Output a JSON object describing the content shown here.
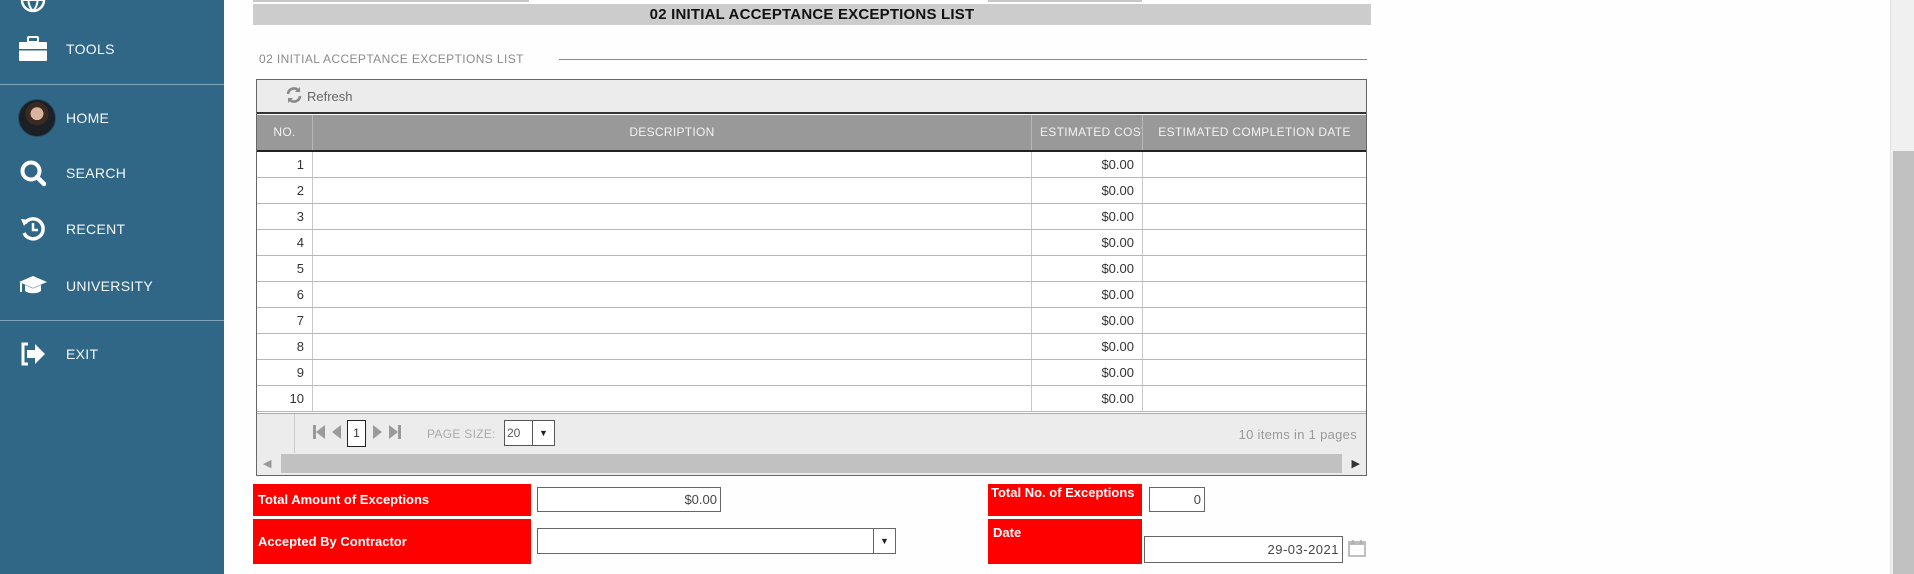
{
  "sidebar": {
    "items": [
      {
        "label": "TOOLS",
        "icon": "briefcase-icon"
      },
      {
        "label": "HOME",
        "icon": "avatar"
      },
      {
        "label": "SEARCH",
        "icon": "search-icon"
      },
      {
        "label": "RECENT",
        "icon": "history-icon"
      },
      {
        "label": "UNIVERSITY",
        "icon": "graduation-cap-icon"
      },
      {
        "label": "EXIT",
        "icon": "exit-icon"
      }
    ]
  },
  "section": {
    "title": "02 INITIAL ACCEPTANCE EXCEPTIONS LIST",
    "legend": "02 INITIAL ACCEPTANCE EXCEPTIONS LIST"
  },
  "grid": {
    "toolbar": {
      "refresh_label": "Refresh"
    },
    "columns": [
      "NO.",
      "DESCRIPTION",
      "ESTIMATED COST",
      "ESTIMATED COMPLETION DATE"
    ],
    "rows": [
      {
        "no": "1",
        "description": "",
        "cost": "$0.00",
        "date": ""
      },
      {
        "no": "2",
        "description": "",
        "cost": "$0.00",
        "date": ""
      },
      {
        "no": "3",
        "description": "",
        "cost": "$0.00",
        "date": ""
      },
      {
        "no": "4",
        "description": "",
        "cost": "$0.00",
        "date": ""
      },
      {
        "no": "5",
        "description": "",
        "cost": "$0.00",
        "date": ""
      },
      {
        "no": "6",
        "description": "",
        "cost": "$0.00",
        "date": ""
      },
      {
        "no": "7",
        "description": "",
        "cost": "$0.00",
        "date": ""
      },
      {
        "no": "8",
        "description": "",
        "cost": "$0.00",
        "date": ""
      },
      {
        "no": "9",
        "description": "",
        "cost": "$0.00",
        "date": ""
      },
      {
        "no": "10",
        "description": "",
        "cost": "$0.00",
        "date": ""
      }
    ],
    "pager": {
      "current_page": "1",
      "page_size_label": "PAGE SIZE:",
      "page_size": "20",
      "info": "10 items in 1 pages"
    }
  },
  "summary": {
    "total_amount_label": "Total Amount of Exceptions",
    "total_amount_value": "$0.00",
    "total_no_label": "Total No. of Exceptions",
    "total_no_value": "0",
    "accepted_label": "Accepted By Contractor",
    "accepted_value": "",
    "date_label": "Date",
    "date_value": "29-03-2021"
  },
  "colors": {
    "sidebar_bg": "#306787",
    "label_red": "#ff0000",
    "header_gray": "#999999",
    "title_bar": "#cccccc"
  }
}
